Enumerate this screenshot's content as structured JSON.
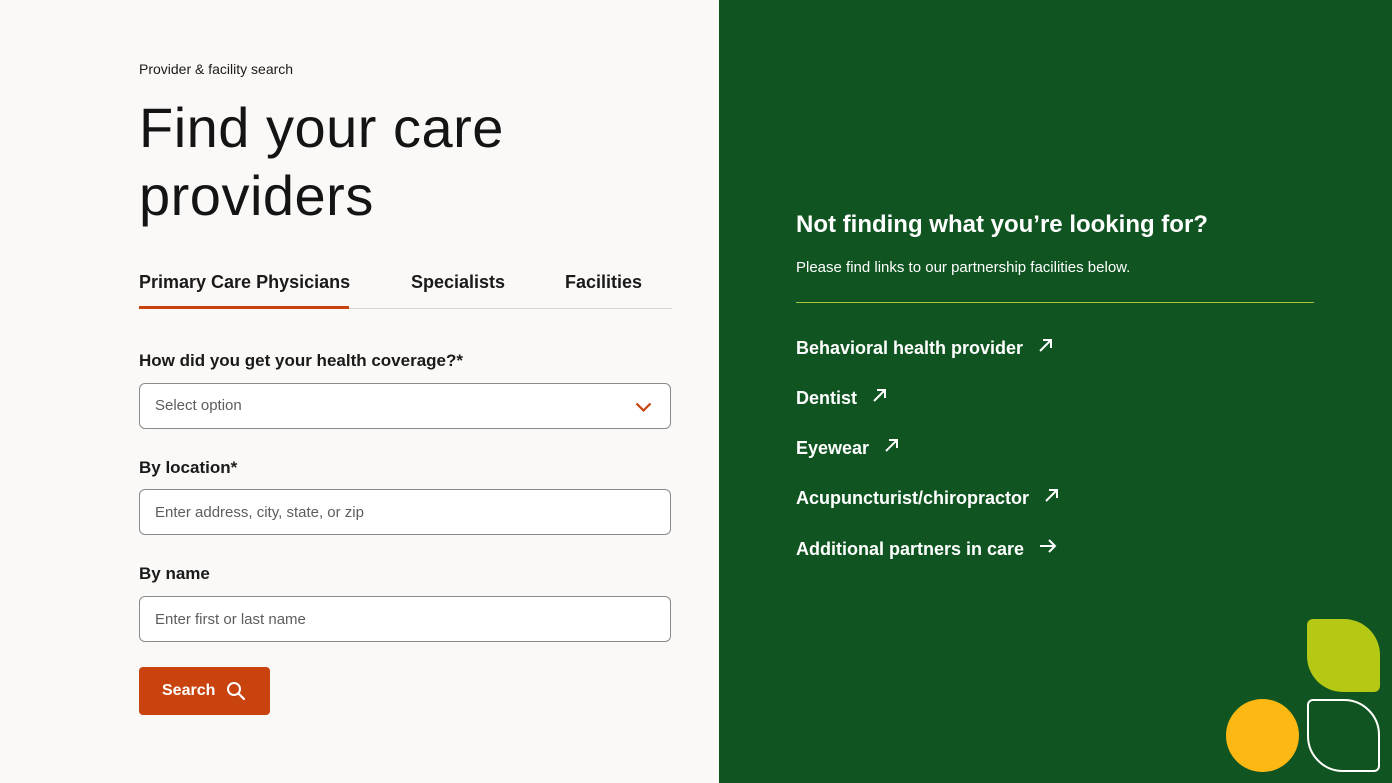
{
  "left": {
    "eyebrow": "Provider & facility search",
    "title_line1": "Find your care",
    "title_line2": "providers",
    "tabs": [
      {
        "label": "Primary Care Physicians",
        "active": true
      },
      {
        "label": "Specialists",
        "active": false
      },
      {
        "label": "Facilities",
        "active": false
      }
    ],
    "coverage": {
      "label": "How did you get your health coverage?*",
      "value": "Select option"
    },
    "location": {
      "label": "By location*",
      "placeholder": "Enter address, city, state, or zip"
    },
    "name": {
      "label": "By name",
      "placeholder": "Enter first or last name"
    },
    "search_button": "Search"
  },
  "right": {
    "heading": "Not finding what you’re looking for?",
    "subtext": "Please find links to our partnership facilities below.",
    "links": [
      {
        "label": "Behavioral health provider",
        "icon": "external-arrow-icon"
      },
      {
        "label": "Dentist",
        "icon": "external-arrow-icon"
      },
      {
        "label": "Eyewear",
        "icon": "external-arrow-icon"
      },
      {
        "label": "Acupuncturist/chiropractor",
        "icon": "external-arrow-icon"
      },
      {
        "label": "Additional partners in care",
        "icon": "arrow-right-icon"
      }
    ]
  },
  "colors": {
    "accent_orange": "#c9430f",
    "panel_green": "#105521",
    "lime": "#b5c814",
    "yellow": "#fdb813",
    "background": "#fbf9f7"
  }
}
